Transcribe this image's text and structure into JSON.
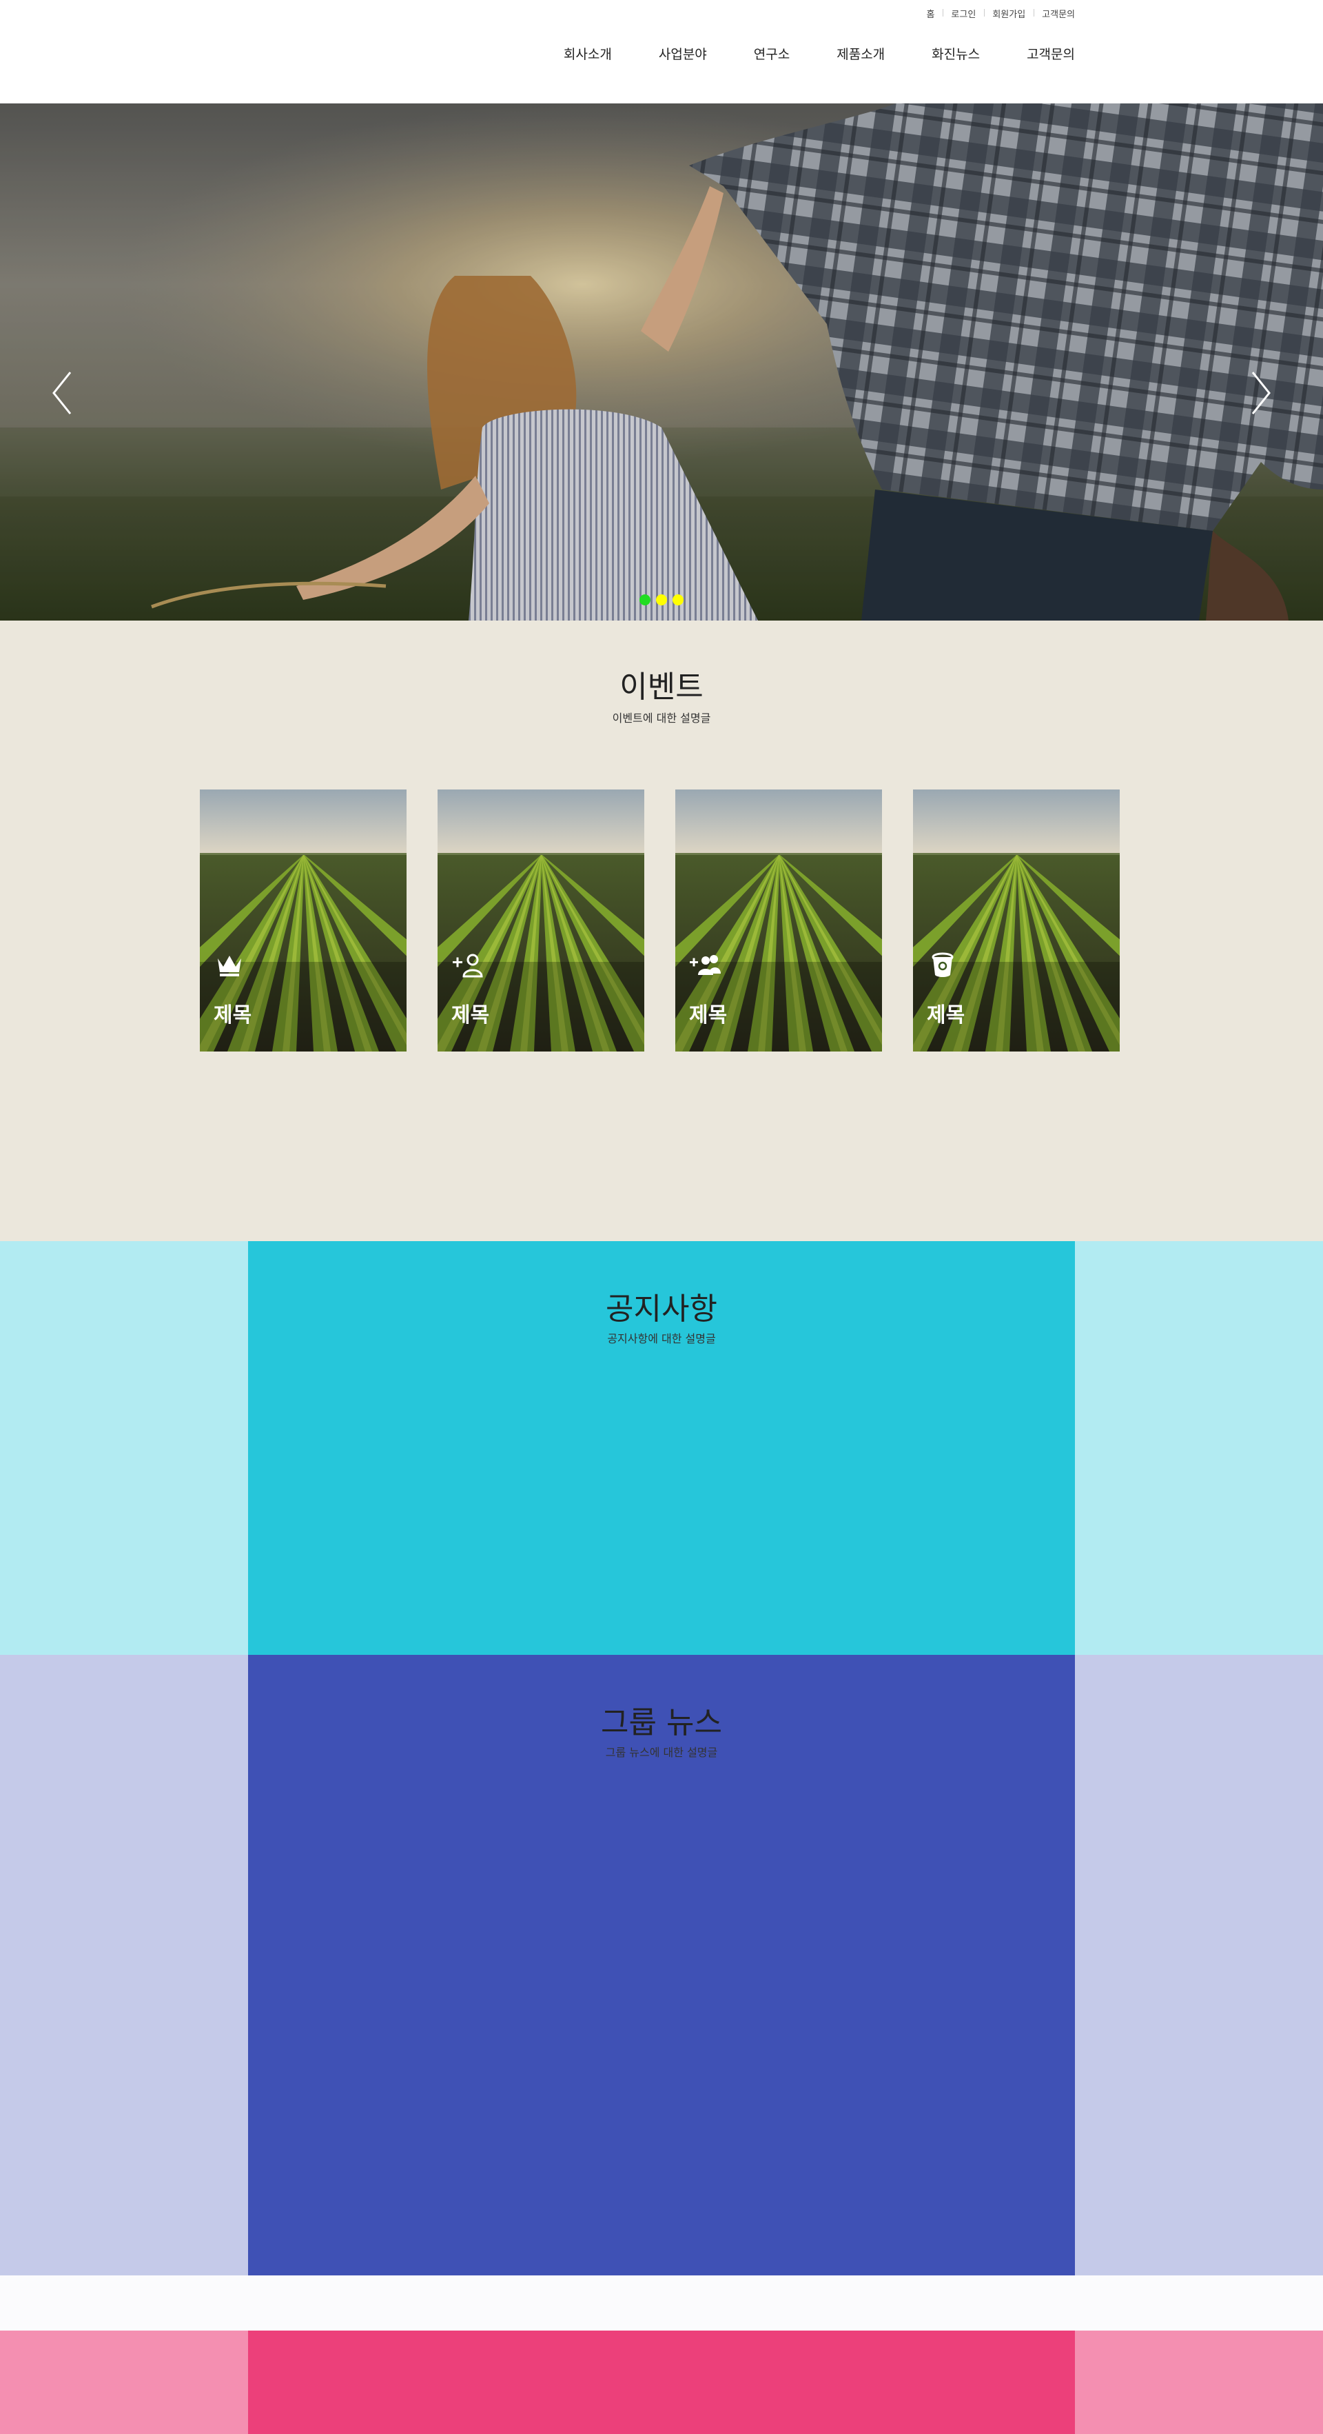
{
  "header": {
    "util_links": [
      "홈",
      "로그인",
      "회원가입",
      "고객문의"
    ],
    "nav": [
      "회사소개",
      "사업분야",
      "연구소",
      "제품소개",
      "화진뉴스",
      "고객문의"
    ]
  },
  "hero": {
    "prev_icon": "chevron-left-icon",
    "next_icon": "chevron-right-icon",
    "slide_count": 3,
    "active_slide": 1,
    "dot_colors": {
      "active": "#22dd22",
      "inactive": "#ffff00"
    }
  },
  "events": {
    "title": "이벤트",
    "subtitle": "이벤트에 대한 설명글",
    "background": "#ebe7dc",
    "cards": [
      {
        "icon": "crown-icon",
        "title": "제목"
      },
      {
        "icon": "add-user-icon",
        "title": "제목"
      },
      {
        "icon": "add-group-icon",
        "title": "제목"
      },
      {
        "icon": "bucket-icon",
        "title": "제목"
      }
    ]
  },
  "notice": {
    "title": "공지사항",
    "subtitle": "공지사항에 대한 설명글",
    "colors": {
      "outer": "#b2ebf2",
      "inner": "#26c6da"
    }
  },
  "group_news": {
    "title": "그룹 뉴스",
    "subtitle": "그룹 뉴스에 대한 설명글",
    "colors": {
      "outer": "#c5cae9",
      "inner": "#3f51b5"
    }
  },
  "footer_band": {
    "colors": {
      "outer": "#f48fb1",
      "inner": "#ec407a"
    }
  }
}
